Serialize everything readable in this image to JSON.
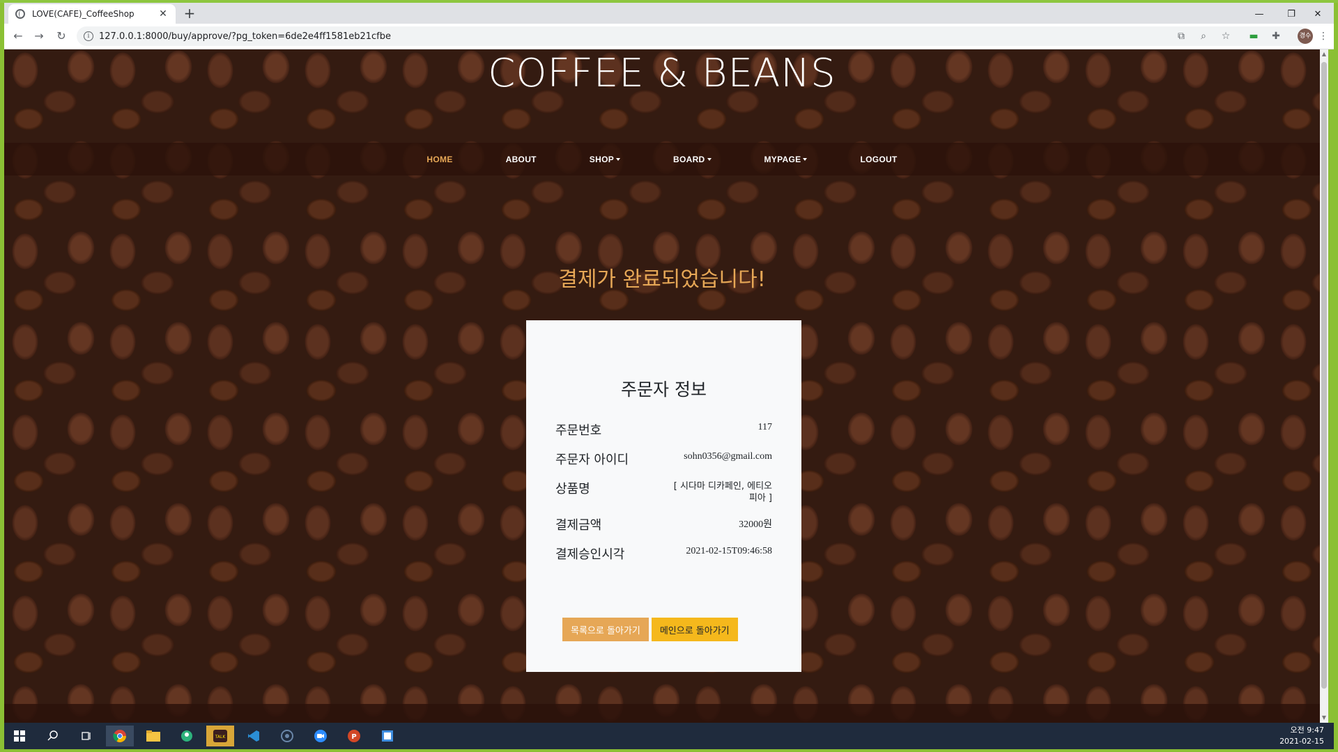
{
  "browser": {
    "tab_title": "LOVE(CAFE)_CoffeeShop",
    "tab_close": "✕",
    "new_tab": "+",
    "url": "127.0.0.1:8000/buy/approve/?pg_token=6de2e4ff1581eb21cfbe",
    "profile_initials": "경수"
  },
  "site": {
    "title": "COFFEE & BEANS",
    "nav": [
      "HOME",
      "ABOUT",
      "SHOP",
      "BOARD",
      "MYPAGE",
      "LOGOUT"
    ]
  },
  "page": {
    "headline": "결제가 완료되었습니다!",
    "card_title": "주문자 정보",
    "rows": [
      {
        "label": "주문번호",
        "value": "117"
      },
      {
        "label": "주문자 아이디",
        "value": "sohn0356@gmail.com"
      },
      {
        "label": "상품명",
        "value": "[ 시다마 디카페인, 에티오피아 ]"
      },
      {
        "label": "결제금액",
        "value": "32000원"
      },
      {
        "label": "결제승인시각",
        "value": "2021-02-15T09:46:58"
      }
    ],
    "btn_list": "목록으로 돌아가기",
    "btn_main": "메인으로 돌아가기"
  },
  "taskbar": {
    "time": "오전 9:47",
    "date": "2021-02-15"
  },
  "colors": {
    "accent": "#e6a756",
    "button_main": "#f5b81c",
    "frame": "#8dc63f"
  }
}
